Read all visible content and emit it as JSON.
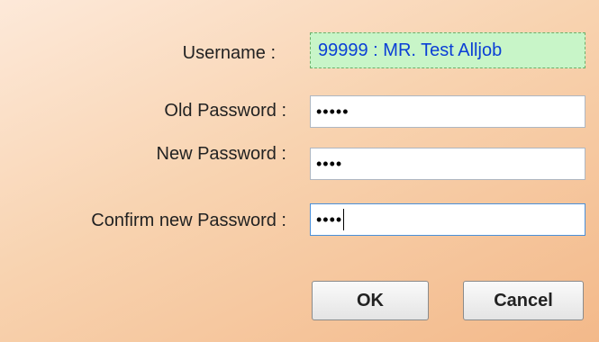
{
  "form": {
    "username_label": "Username :",
    "username_value": "99999 : MR. Test Alljob",
    "old_password_label": "Old Password :",
    "old_password_value": "•••••",
    "new_password_label": "New Password :",
    "new_password_value": "••••",
    "confirm_password_label": "Confirm new Password :",
    "confirm_password_value": "••••"
  },
  "buttons": {
    "ok_label": "OK",
    "cancel_label": "Cancel"
  },
  "colors": {
    "username_bg": "#c8f5c8",
    "username_text": "#0b3fd6",
    "focus_border": "#4a90d9"
  }
}
